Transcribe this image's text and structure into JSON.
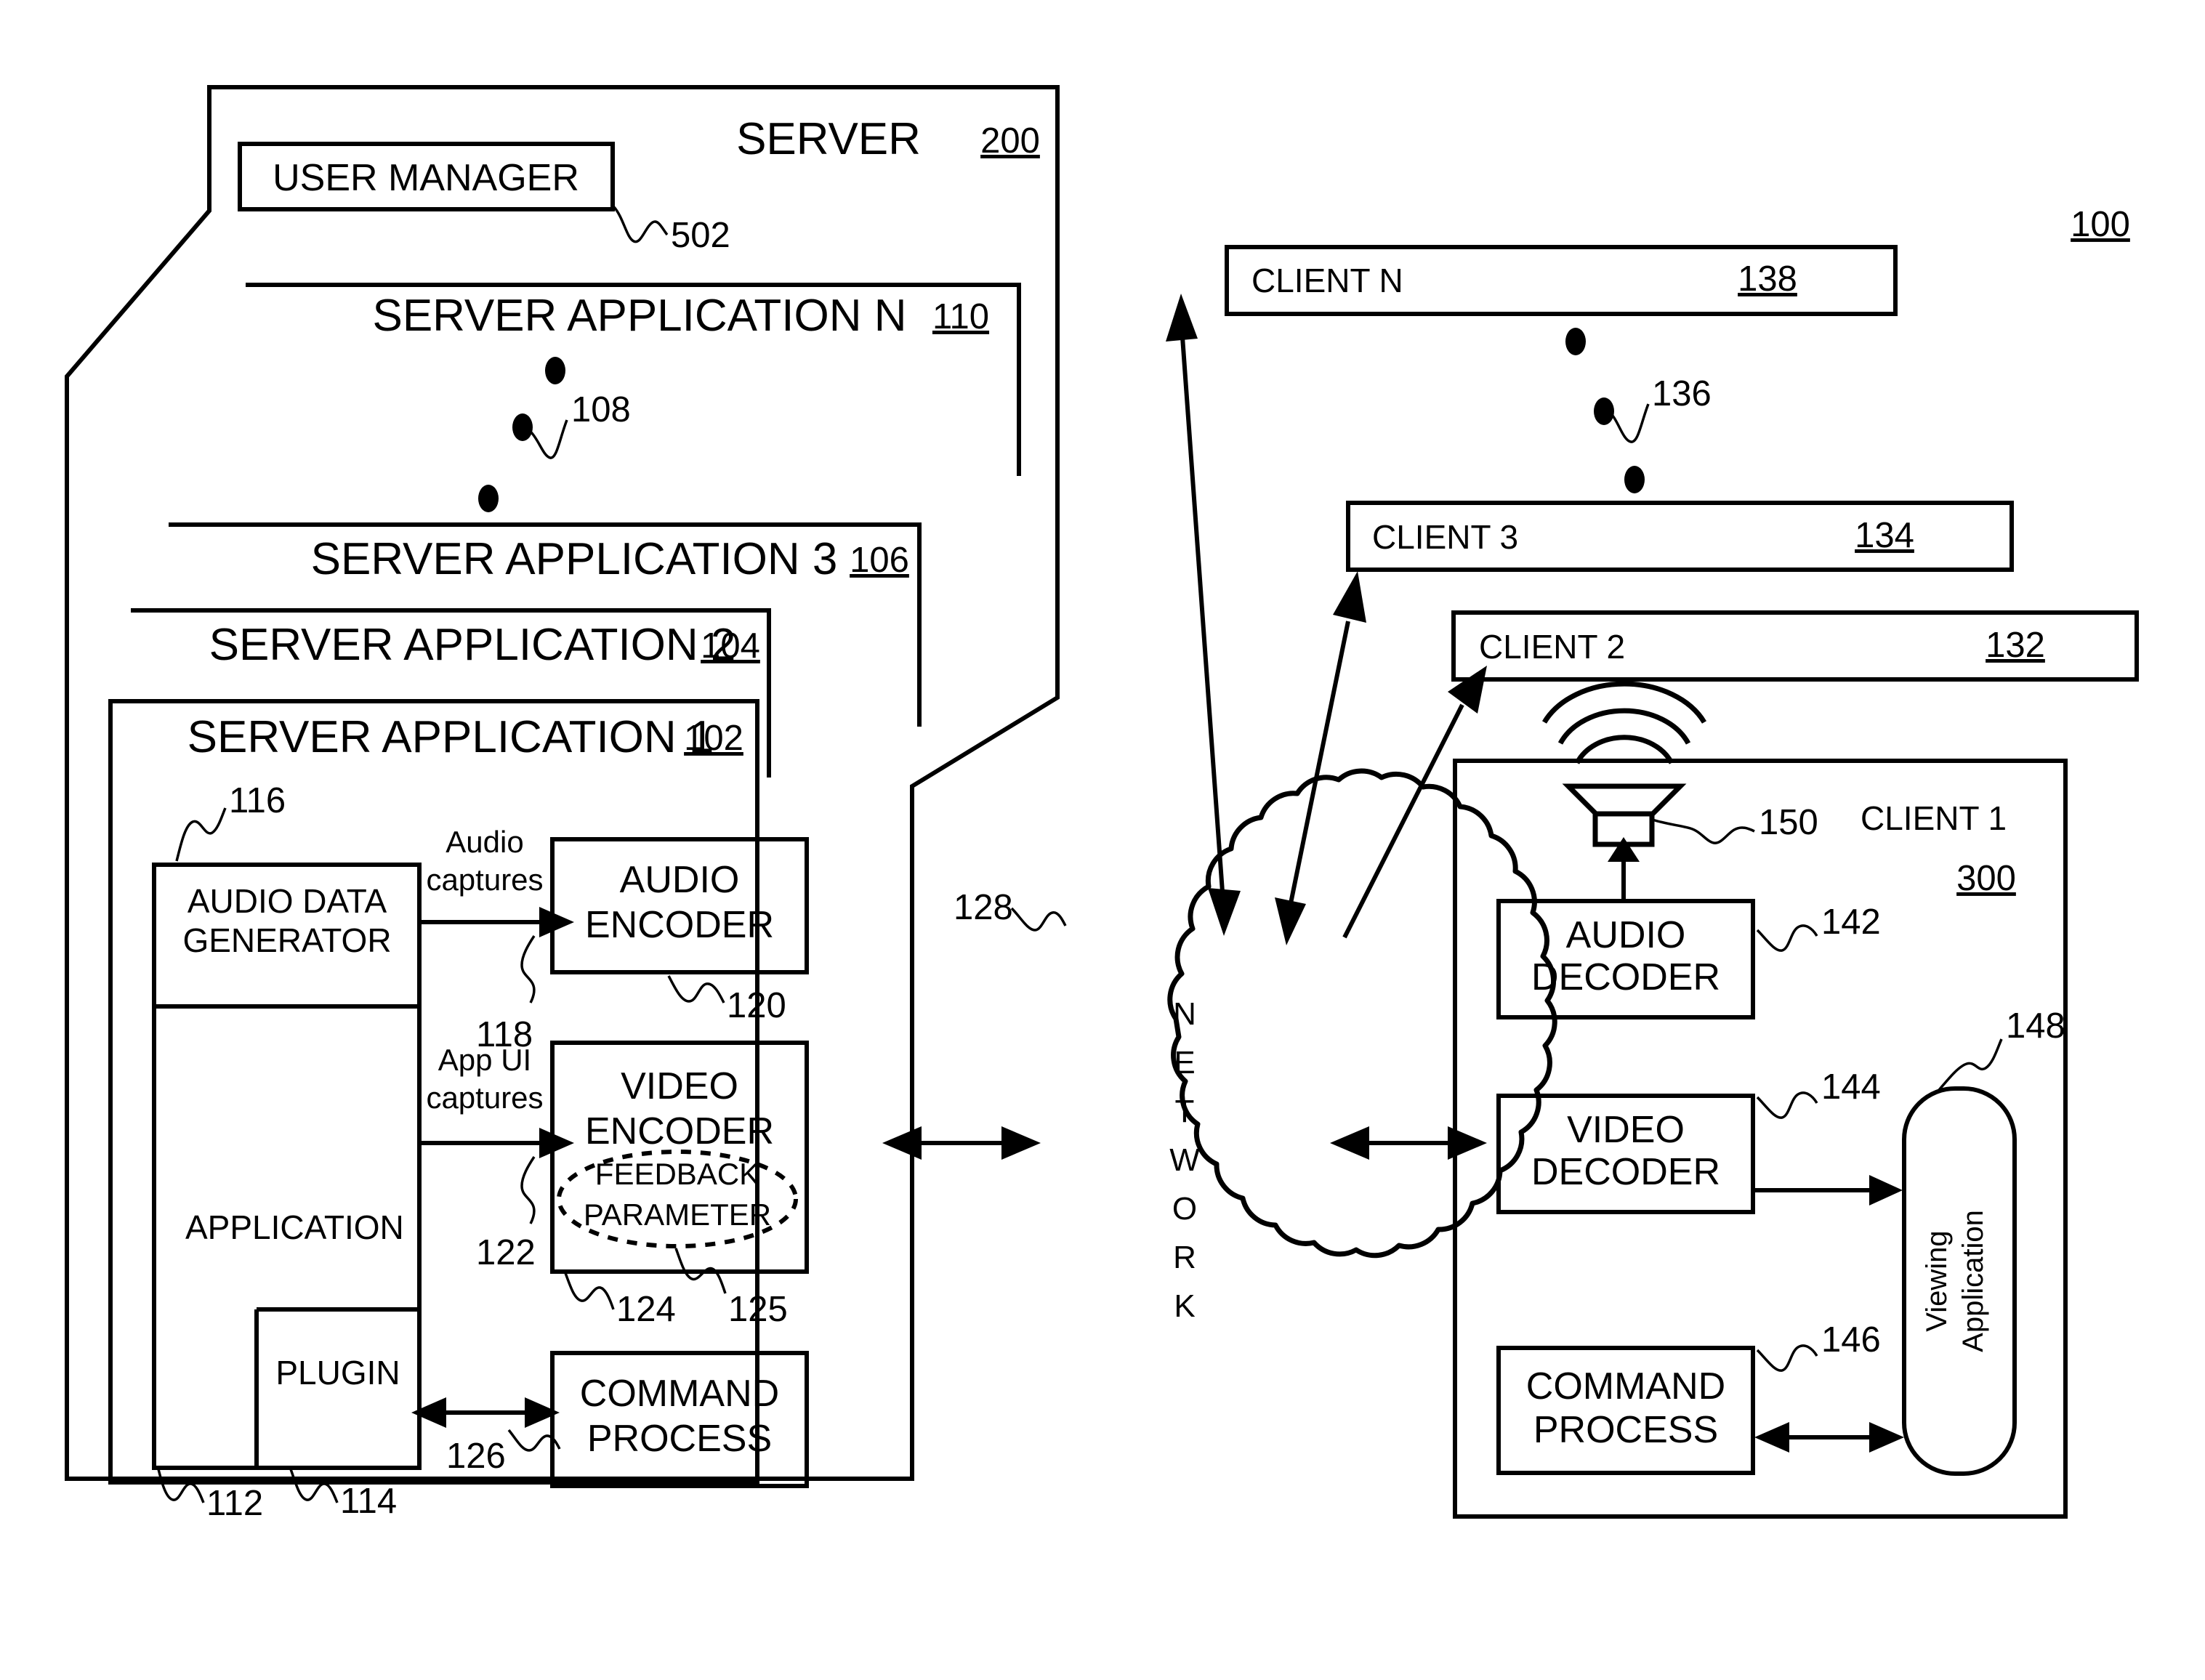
{
  "figure": {
    "overall_ref": "100"
  },
  "server": {
    "title": "SERVER",
    "ref": "200",
    "user_manager": {
      "label": "USER MANAGER",
      "ref": "502"
    },
    "applications": [
      {
        "label": "SERVER APPLICATION N",
        "ref": "110"
      },
      {
        "label": "SERVER APPLICATION 3",
        "ref": "106"
      },
      {
        "label": "SERVER APPLICATION 2",
        "ref": "104"
      },
      {
        "label": "SERVER APPLICATION 1",
        "ref": "102"
      }
    ],
    "ellipsis_ref": "108",
    "app1": {
      "outer_ref": "112",
      "audio_data_generator": {
        "label_line1": "AUDIO DATA",
        "label_line2": "GENERATOR",
        "ref": "116"
      },
      "application": {
        "label": "APPLICATION"
      },
      "plugin": {
        "label": "PLUGIN",
        "ref": "114"
      },
      "audio_captures": {
        "label_line1": "Audio",
        "label_line2": "captures",
        "ref": "118"
      },
      "appui_captures": {
        "label_line1": "App UI",
        "label_line2": "captures",
        "ref": "122"
      },
      "audio_encoder": {
        "label_line1": "AUDIO",
        "label_line2": "ENCODER",
        "ref": "120"
      },
      "video_encoder": {
        "label_line1": "VIDEO",
        "label_line2": "ENCODER",
        "ref": "124"
      },
      "feedback_parameter": {
        "label_line1": "FEEDBACK",
        "label_line2": "PARAMETER",
        "ref": "125"
      },
      "command_process": {
        "label_line1": "COMMAND",
        "label_line2": "PROCESS",
        "ref": "126"
      }
    }
  },
  "network": {
    "letters": [
      "N",
      "E",
      "T",
      "W",
      "O",
      "R",
      "K"
    ],
    "ref": "128"
  },
  "clients": [
    {
      "label": "CLIENT N",
      "ref": "138"
    },
    {
      "label": "CLIENT 3",
      "ref": "134"
    },
    {
      "label": "CLIENT 2",
      "ref": "132"
    }
  ],
  "clients_ellipsis_ref": "136",
  "client1": {
    "title": "CLIENT 1",
    "ref": "300",
    "speaker_ref": "150",
    "audio_decoder": {
      "label_line1": "AUDIO",
      "label_line2": "DECODER",
      "ref": "142"
    },
    "video_decoder": {
      "label_line1": "VIDEO",
      "label_line2": "DECODER",
      "ref": "144"
    },
    "command_process": {
      "label_line1": "COMMAND",
      "label_line2": "PROCESS",
      "ref": "146"
    },
    "viewing_application": {
      "label_line1": "Viewing",
      "label_line2": "Application",
      "ref": "148"
    }
  },
  "colors": {
    "ink": "#000000",
    "paper": "#ffffff"
  }
}
